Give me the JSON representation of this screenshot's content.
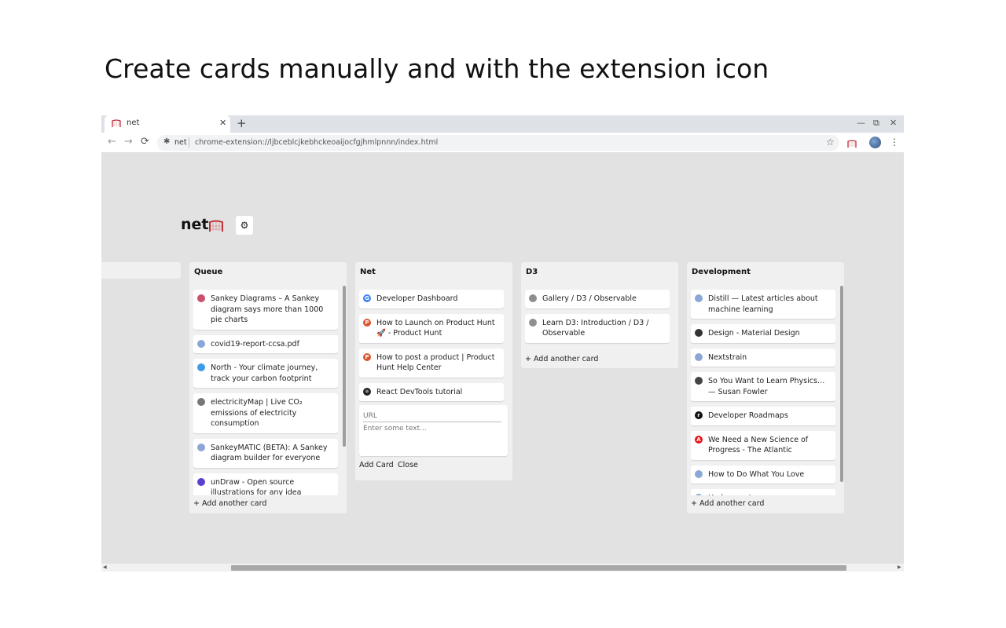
{
  "headline": "Create cards manually and with the extension icon",
  "browser": {
    "tab_title": "net",
    "close_glyph": "✕",
    "new_tab_glyph": "+",
    "minimize_glyph": "—",
    "restore_glyph": "⧉",
    "close_window_glyph": "✕",
    "back_glyph": "←",
    "forward_glyph": "→",
    "reload_glyph": "⟳",
    "site_label": "net",
    "url": "chrome-extension://ljbceblcjkebhckeoaijocfgjhmlpnnn/index.html",
    "star_glyph": "☆",
    "menu_glyph": "⋮"
  },
  "app": {
    "logo_text": "net",
    "settings_glyph": "⚙"
  },
  "columns": [
    {
      "title": "Queue",
      "add_label": "+ Add another card",
      "cards": [
        {
          "text": "Sankey Diagrams – A Sankey diagram says more than 1000 pie charts",
          "icon": "sankey-favicon",
          "color": "#c9516b"
        },
        {
          "text": "covid19-report-ccsa.pdf",
          "icon": "globe-icon",
          "color": "#8ca7d6"
        },
        {
          "text": "North - Your climate journey, track your carbon footprint",
          "icon": "north-favicon",
          "color": "#3d9be9"
        },
        {
          "text": "electricityMap | Live CO₂ emissions of electricity consumption",
          "icon": "electricitymap-favicon",
          "color": "#777777"
        },
        {
          "text": "SankeyMATIC (BETA): A Sankey diagram builder for everyone",
          "icon": "globe-icon",
          "color": "#8ca7d6"
        },
        {
          "text": "unDraw - Open source illustrations for any idea",
          "icon": "undraw-favicon",
          "color": "#5b3fd1"
        }
      ]
    },
    {
      "title": "Net",
      "cards": [
        {
          "text": "Developer Dashboard",
          "icon": "google-icon",
          "color": "#4285f4",
          "letter": "G"
        },
        {
          "text": "How to Launch on Product Hunt 🚀 - Product Hunt",
          "icon": "producthunt-icon",
          "color": "#da552f",
          "letter": "P"
        },
        {
          "text": "How to post a product | Product Hunt Help Center",
          "icon": "producthunt-icon",
          "color": "#da552f",
          "letter": "P"
        },
        {
          "text": "React DevTools tutorial",
          "icon": "react-icon",
          "color": "#20232a",
          "letter": "⚛"
        }
      ],
      "form": {
        "url_placeholder": "URL",
        "text_placeholder": "Enter some text...",
        "add_label": "Add Card",
        "close_label": "Close"
      }
    },
    {
      "title": "D3",
      "add_label": "+ Add another card",
      "cards": [
        {
          "text": "Gallery / D3 / Observable",
          "icon": "observable-icon",
          "color": "#8f8f8f"
        },
        {
          "text": "Learn D3: Introduction / D3 / Observable",
          "icon": "observable-icon",
          "color": "#8f8f8f"
        }
      ]
    },
    {
      "title": "Development",
      "add_label": "+ Add another card",
      "cards": [
        {
          "text": "Distill — Latest articles about machine learning",
          "icon": "globe-icon",
          "color": "#8ca7d6"
        },
        {
          "text": "Design - Material Design",
          "icon": "material-icon",
          "color": "#333333"
        },
        {
          "text": "Nextstrain",
          "icon": "globe-icon",
          "color": "#8ca7d6"
        },
        {
          "text": "So You Want to Learn Physics… — Susan Fowler",
          "icon": "cube-icon",
          "color": "#444444"
        },
        {
          "text": "Developer Roadmaps",
          "icon": "roadmap-icon",
          "color": "#111111",
          "letter": "r"
        },
        {
          "text": "We Need a New Science of Progress - The Atlantic",
          "icon": "atlantic-icon",
          "color": "#e7131a",
          "letter": "A"
        },
        {
          "text": "How to Do What You Love",
          "icon": "globe-icon",
          "color": "#8ca7d6"
        },
        {
          "text": "Hedonometer",
          "icon": "globe-icon",
          "color": "#8ca7d6"
        }
      ]
    }
  ]
}
